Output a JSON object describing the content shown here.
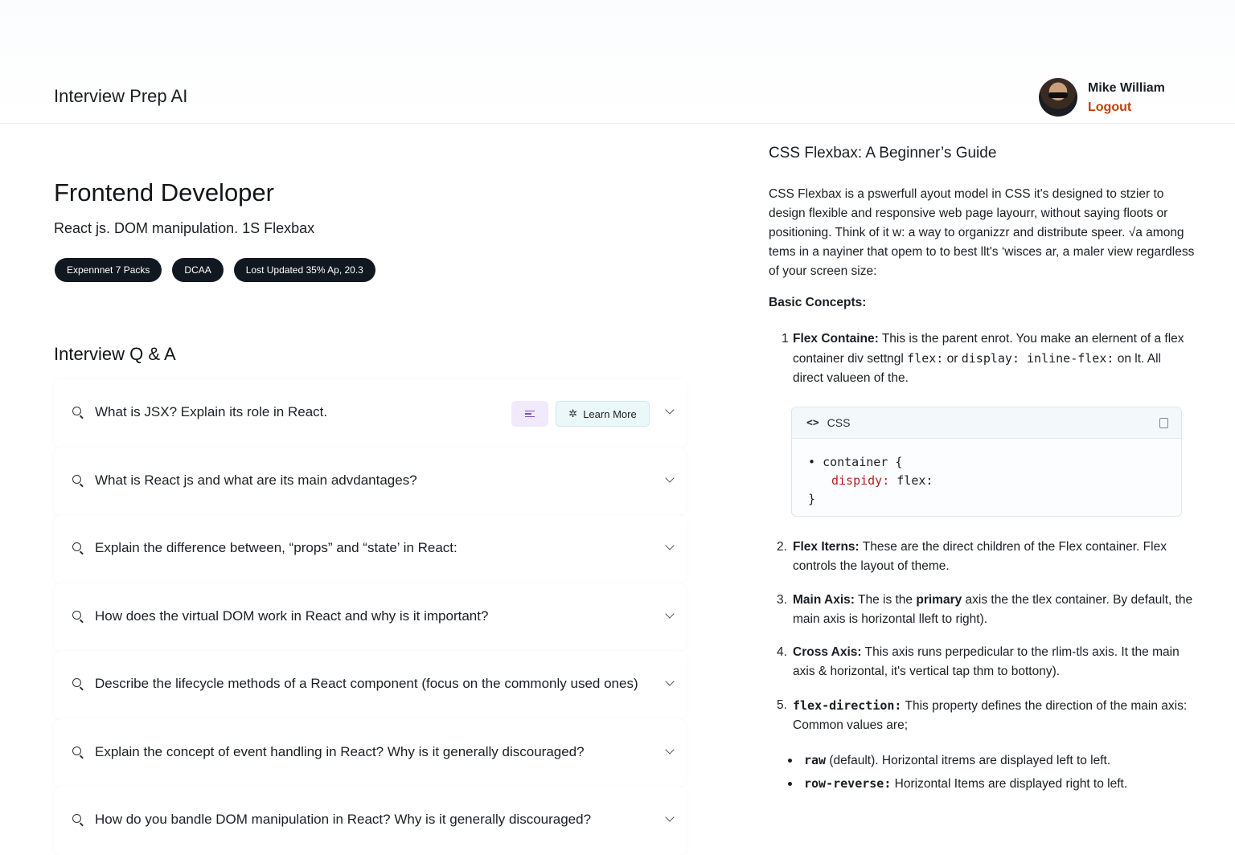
{
  "header": {
    "app_title": "Interview Prep AI",
    "user_name": "Mike William",
    "logout_label": "Logout"
  },
  "role": {
    "title": "Frontend Developer",
    "topics": "React js. DOM manipulation. 1S Flexbax",
    "badges": [
      "Expennnet 7 Packs",
      "DCAA",
      "Lost Updated 35% Ap, 20.3"
    ]
  },
  "qa": {
    "title": "Interview Q & A",
    "learn_more_label": "Learn More",
    "questions": [
      "What is JSX? Explain its role in React.",
      "What is React js and what are its main advdantages?",
      "Explain the difference between, “props” and “state’ in React:",
      "How does the virtual DOM work in React and why is it important?",
      "Describe the lifecycle methods of a React component (focus on the commonly used ones)",
      "Explain the concept of event handling in React? Why is it generally discouraged?",
      "How do you bandle DOM manipulation in React? Why is it generally discouraged?"
    ]
  },
  "guide": {
    "title": "CSS Flexbax: A Beginner’s Guide",
    "intro": "CSS Flexbax is a pswerfull ayout model in CSS it's designed to stzier to design flexible and responsive web page layourr, without saying floots or positioning. Think of it w: a way to organizzr and distribute speer. √a among tems in a nayiner that opem to to best llt's ‘wisces ar, a maler view regardless of your screen size:",
    "concepts_heading": "Basic Concepts:",
    "item1": {
      "num": "1",
      "term": "Flex Containe:",
      "text_a": " This is the parent enrot. You make an elernent of a flex container div settngl ",
      "code_a": "flex:",
      "text_b": " or ",
      "code_b": "display: inline-flex:",
      "text_c": " on lt. All direct valueen of the."
    },
    "code_block": {
      "lang": "CSS",
      "lang_icon": "<>",
      "line1": "container {",
      "prop": "dispidy:",
      "value": " flex:",
      "line3": "}"
    },
    "item2": {
      "num": "2.",
      "term": "Flex Iterns:",
      "text": " These are the direct children of the Flex container. Flex controls the layout of theme."
    },
    "item3": {
      "num": "3.",
      "term": "Main Axis:",
      "text_a": " The is the ",
      "bold": "primary",
      "text_b": " axis the the tlex container. By default, the main axis is horizontal lleft to right)."
    },
    "item4": {
      "num": "4.",
      "term": "Cross Axis:",
      "text": " This axis runs perpedicular to the rlim-tls axis. It the main axis & horizontal, it's vertical tap thm to bottony)."
    },
    "item5": {
      "num": "5.",
      "term": "flex-direction:",
      "text": "  This property defines the direction of the main axis: Common values are;"
    },
    "bullets": [
      {
        "term": "raw",
        "text": " (default). Horizontal itrems are displayed left to left."
      },
      {
        "term": "row-reverse:",
        "text": " Horizontal Items are displayed right to left."
      }
    ]
  }
}
